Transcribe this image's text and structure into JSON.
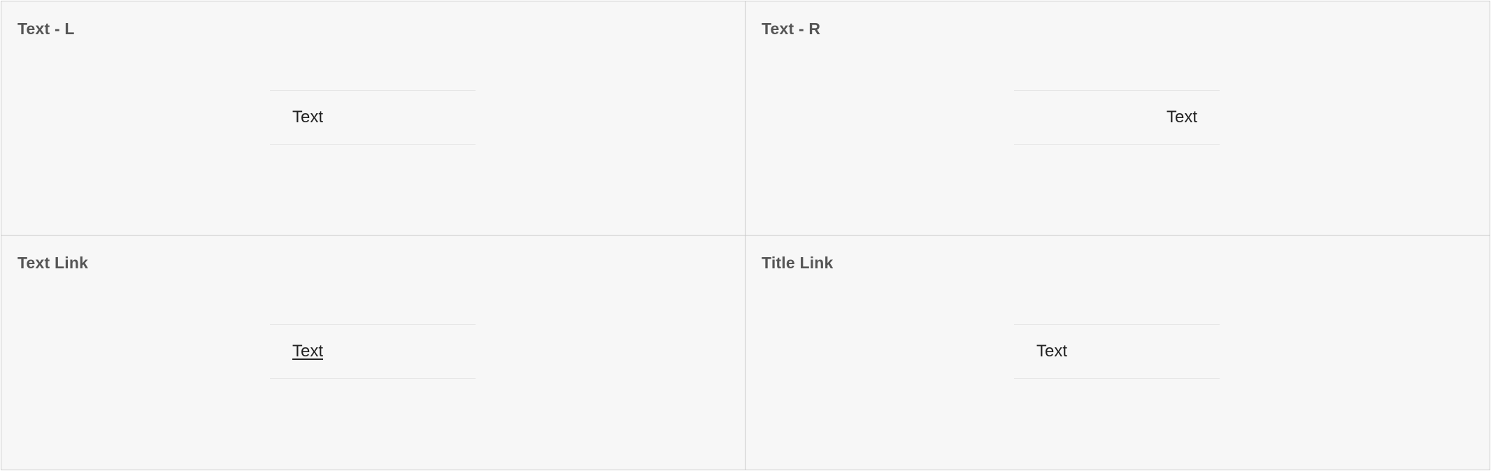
{
  "panels": {
    "text_left": {
      "title": "Text - L",
      "cell_text": "Text"
    },
    "text_right": {
      "title": "Text - R",
      "cell_text": "Text"
    },
    "text_link": {
      "title": "Text Link",
      "cell_text": "Text"
    },
    "title_link": {
      "title": "Title Link",
      "cell_text": "Text"
    }
  },
  "colors": {
    "panel_background": "#f7f7f7",
    "panel_border": "#c8c8c8",
    "title_text": "#555555",
    "cell_text": "#222222",
    "cell_divider": "#e6e6e6"
  }
}
